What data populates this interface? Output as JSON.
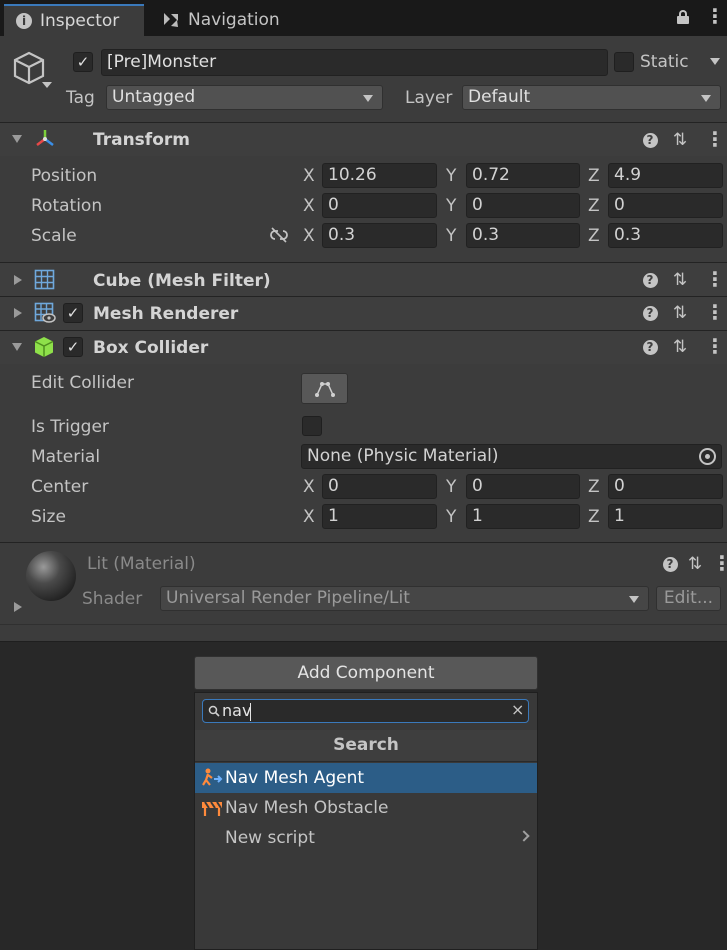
{
  "tabs": {
    "inspector": "Inspector",
    "navigation": "Navigation"
  },
  "object": {
    "name": "[Pre]Monster",
    "static_label": "Static",
    "tag_label": "Tag",
    "tag_value": "Untagged",
    "layer_label": "Layer",
    "layer_value": "Default"
  },
  "transform": {
    "title": "Transform",
    "rows": [
      {
        "label": "Position",
        "x": "10.26",
        "y": "0.72",
        "z": "4.9"
      },
      {
        "label": "Rotation",
        "x": "0",
        "y": "0",
        "z": "0"
      },
      {
        "label": "Scale",
        "x": "0.3",
        "y": "0.3",
        "z": "0.3"
      }
    ]
  },
  "axes": {
    "x": "X",
    "y": "Y",
    "z": "Z"
  },
  "mesh_filter": {
    "title": "Cube (Mesh Filter)"
  },
  "mesh_renderer": {
    "title": "Mesh Renderer"
  },
  "box_collider": {
    "title": "Box Collider",
    "edit_collider": "Edit Collider",
    "is_trigger": "Is Trigger",
    "material_label": "Material",
    "material_value": "None (Physic Material)",
    "center_label": "Center",
    "center": {
      "x": "0",
      "y": "0",
      "z": "0"
    },
    "size_label": "Size",
    "size": {
      "x": "1",
      "y": "1",
      "z": "1"
    }
  },
  "material": {
    "title": "Lit (Material)",
    "shader_label": "Shader",
    "shader_value": "Universal Render Pipeline/Lit",
    "edit_label": "Edit..."
  },
  "add_component": {
    "label": "Add Component",
    "search_value": "nav",
    "section": "Search",
    "items": [
      {
        "label": "Nav Mesh Agent"
      },
      {
        "label": "Nav Mesh Obstacle"
      },
      {
        "label": "New script"
      }
    ]
  },
  "colors": {
    "accent": "#3a79bb",
    "selected": "#2c5d87",
    "panel": "#3c3c3c"
  }
}
